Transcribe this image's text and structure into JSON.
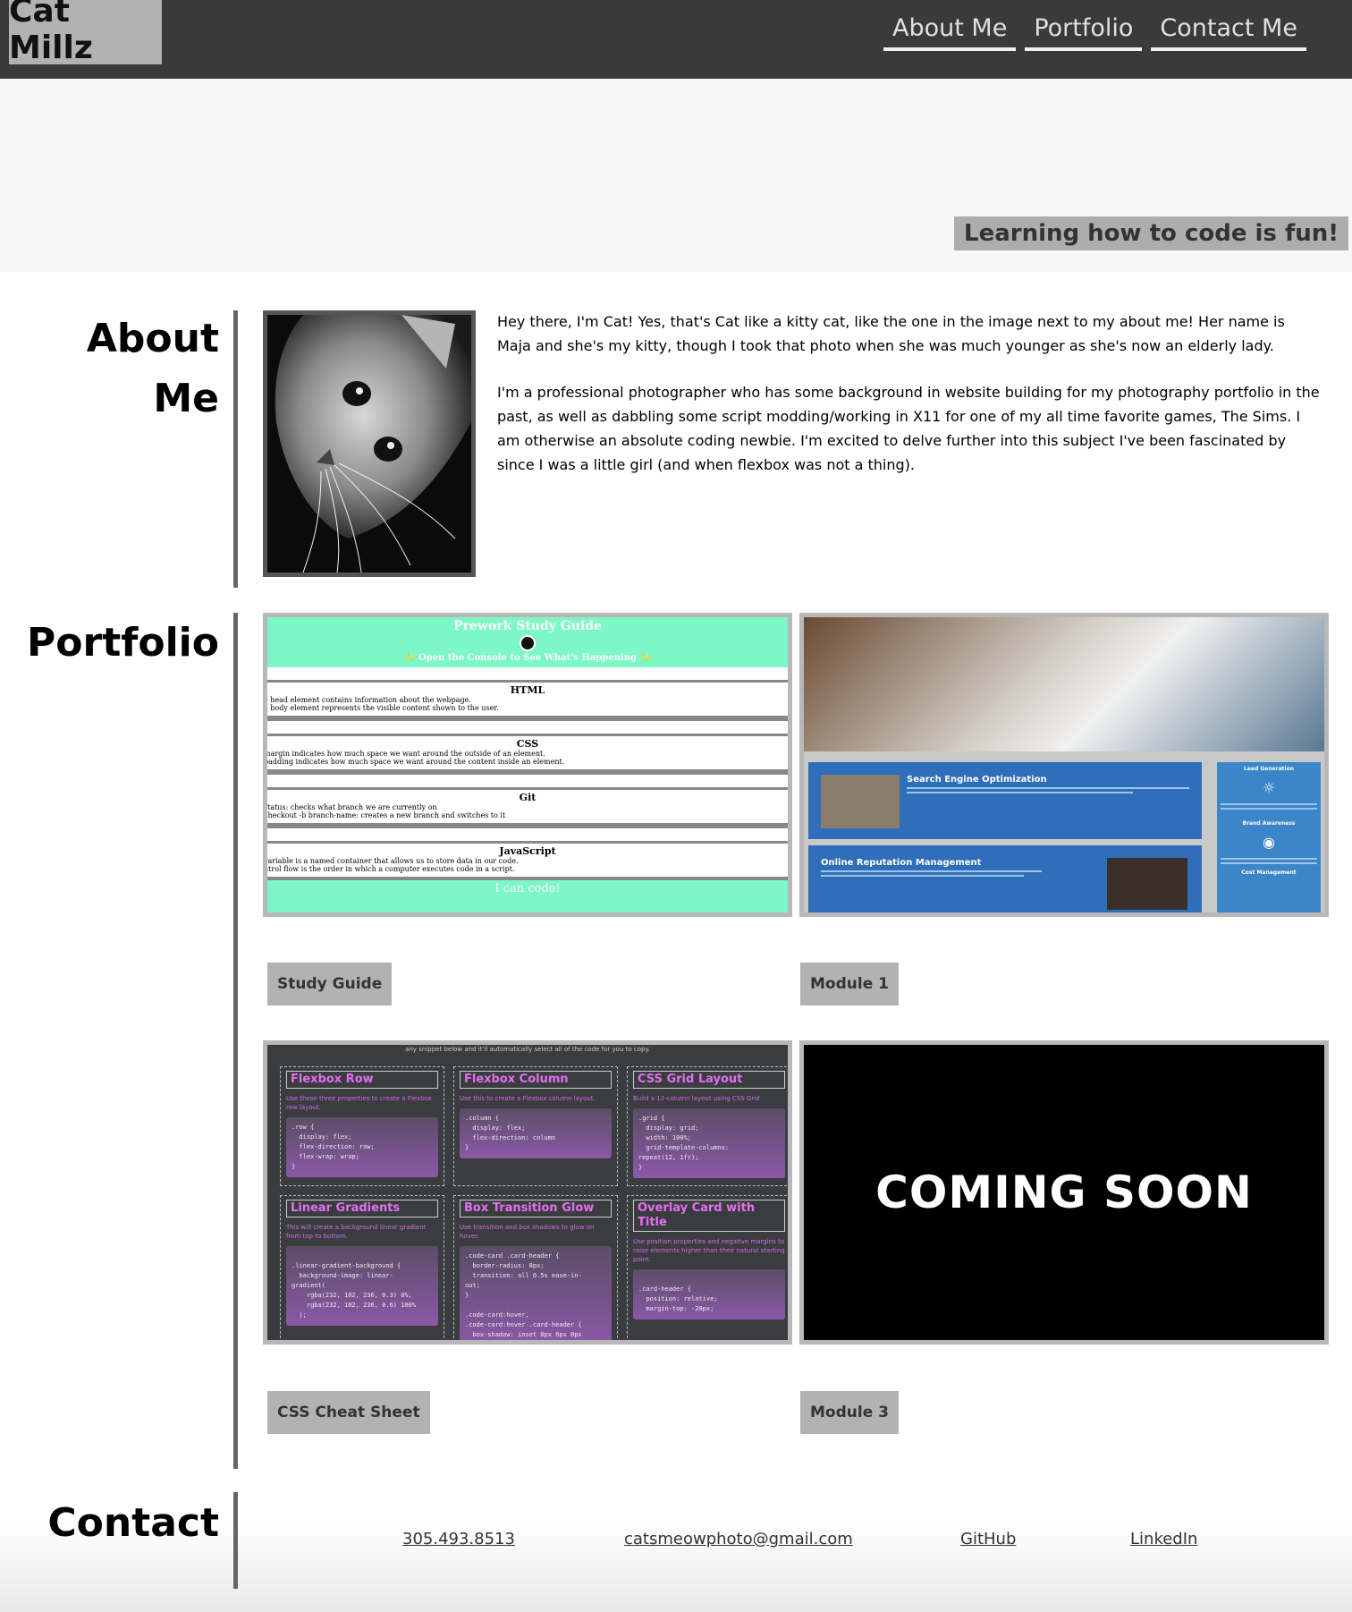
{
  "header": {
    "brand": "Cat Millz",
    "nav": [
      "About Me",
      "Portfolio",
      "Contact Me"
    ]
  },
  "hero": {
    "tagline": "Learning how to code is fun!"
  },
  "about": {
    "title": "About Me",
    "paragraphs": [
      "Hey there, I'm Cat! Yes, that's Cat like a kitty cat, like the one in the image next to my about me! Her name is Maja and she's my kitty, though I took that photo when she was much younger as she's now an elderly lady.",
      "I'm a professional photographer who has some background in website building for my photography portfolio in the past, as well as dabbling some script modding/working in X11 for one of my all time favorite games, The Sims. I am otherwise an absolute coding newbie. I'm excited to delve further into this subject I've been fascinated by since I was a little girl (and when flexbox was not a thing)."
    ]
  },
  "portfolio": {
    "title": "Portfolio",
    "projects": [
      {
        "label": "Study Guide"
      },
      {
        "label": "Module 1"
      },
      {
        "label": "CSS Cheat Sheet"
      },
      {
        "label": "Module 3"
      }
    ],
    "study_guide_preview": {
      "title": "Prework Study Guide",
      "subtitle": "✨ Open the Console to See What's Happening ✨",
      "blocks": [
        {
          "heading": "HTML",
          "lines": [
            "e head element contains information about the webpage.",
            "e body element represents the visible content shown to the user."
          ]
        },
        {
          "heading": "CSS",
          "lines": [
            "margin indicates how much space we want around the outside of an element.",
            "padding indicates how much space we want around the content inside an element."
          ]
        },
        {
          "heading": "Git",
          "lines": [
            "status: checks what branch we are currently on",
            "checkout -b branch-name: creates a new branch and switches to it"
          ]
        },
        {
          "heading": "JavaScript",
          "lines": [
            "variable is a named container that allows us to store data in our code.",
            "ntrol flow is the order in which a computer executes code in a script."
          ]
        }
      ],
      "footer": "I can code!"
    },
    "module1_preview": {
      "box1_title": "Search Engine Optimization",
      "box2_title": "Online Reputation Management",
      "side_title_1": "Lead Generation",
      "side_title_2": "Brand Awareness",
      "side_title_3": "Cost Management"
    },
    "cheatsheet_preview": {
      "top_text": "any snippet below and it'll automatically select all of the code for you to copy.",
      "cells": [
        {
          "title": "Flexbox Row",
          "desc": "Use these three properties to create a Flexbox row layout.",
          "code": ".row {\n  display: flex;\n  flex-direction: row;\n  flex-wrap: wrap;\n}"
        },
        {
          "title": "Flexbox Column",
          "desc": "Use this to create a Flexbox column layout.",
          "code": ".column {\n  display: flex;\n  flex-direction: column\n}"
        },
        {
          "title": "CSS Grid Layout",
          "desc": "Build a 12-column layout using CSS Grid",
          "code": ".grid {\n  display: grid;\n  width: 100%;\n  grid-template-columns:\nrepeat(12, 1fr);\n}"
        },
        {
          "title": "Linear Gradients",
          "desc": "This will create a background linear gradient from top to bottom.",
          "code": "\n.linear-gradient-background {\n  background-image: linear-\ngradient(\n    rgba(232, 102, 236, 0.3) 0%,\n    rgba(232, 102, 236, 0.6) 100%\n  );"
        },
        {
          "title": "Box Transition Glow",
          "desc": "Use transition and box shadows to glow on hover.",
          "code": ".code-card .card-header {\n  border-radius: 8px;\n  transition: all 0.5s ease-in-\nout;\n}\n\n.code-card:hover,\n.code-card:hover .card-header {\n  box-shadow: inset 0px 0px 8px"
        },
        {
          "title": "Overlay Card with Title",
          "desc": "Use position properties and negative margins to raise elements higher than their natural starting point.",
          "code": "\n.card-header {\n  position: relative;\n  margin-top: -20px;"
        }
      ]
    },
    "module3_preview": {
      "text": "COMING SOON"
    }
  },
  "contact": {
    "title": "Contact",
    "phone": "305.493.8513",
    "email": "catsmeowphoto@gmail.com",
    "github": "GitHub",
    "linkedin": "LinkedIn"
  },
  "colors": {
    "header_bg": "#3a3a3a",
    "accent_gray": "#b2b2b2",
    "mint": "#7ef7c6",
    "seo_blue": "#2f6eb8",
    "cheat_purple": "#e36ff0"
  }
}
